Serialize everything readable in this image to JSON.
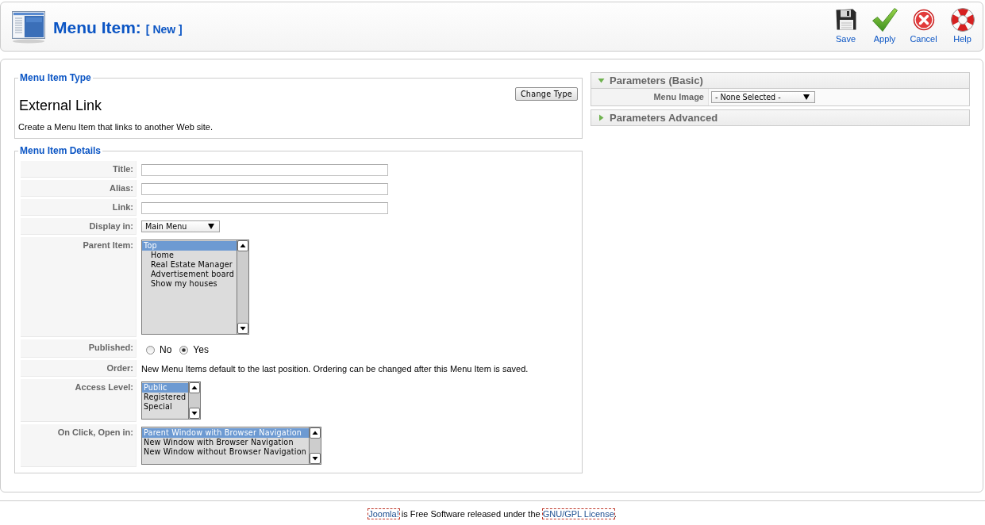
{
  "header": {
    "title": "Menu Item:",
    "subtitle": "[ New ]"
  },
  "toolbar": [
    {
      "kind": "save",
      "label": "Save"
    },
    {
      "kind": "apply",
      "label": "Apply"
    },
    {
      "kind": "cancel",
      "label": "Cancel"
    },
    {
      "kind": "help",
      "label": "Help"
    }
  ],
  "menu_item_type": {
    "legend": "Menu Item Type",
    "type_name": "External Link",
    "change_button": "Change Type",
    "description": "Create a Menu Item that links to another Web site."
  },
  "menu_item_details": {
    "legend": "Menu Item Details",
    "rows": [
      {
        "kind": "text",
        "label": "Title:"
      },
      {
        "kind": "text",
        "label": "Alias:"
      },
      {
        "kind": "text",
        "label": "Link:"
      },
      {
        "kind": "select",
        "label": "Display in:",
        "value": "Main Menu"
      },
      {
        "kind": "listbox",
        "label": "Parent Item:",
        "options": [
          {
            "label": "Top",
            "selected": true,
            "children": [
              {
                "label": "Home",
                "selected": false
              },
              {
                "label": "Real Estate Manager",
                "selected": false
              },
              {
                "label": "Advertisement board",
                "selected": false
              },
              {
                "label": "Show my houses",
                "selected": false
              }
            ]
          }
        ]
      },
      {
        "kind": "radio",
        "label": "Published:",
        "options": [
          {
            "label": "No",
            "selected": false
          },
          {
            "label": "Yes",
            "selected": true
          }
        ]
      },
      {
        "kind": "note",
        "label": "Order:",
        "text": "New Menu Items default to the last position. Ordering can be changed after this Menu Item is saved."
      },
      {
        "kind": "listbox",
        "label": "Access Level:",
        "options": [
          {
            "label": "Public",
            "selected": true
          },
          {
            "label": "Registered",
            "selected": false
          },
          {
            "label": "Special",
            "selected": false
          }
        ]
      },
      {
        "kind": "listbox",
        "label": "On Click, Open in:",
        "options": [
          {
            "label": "Parent Window with Browser Navigation",
            "selected": true
          },
          {
            "label": "New Window with Browser Navigation",
            "selected": false
          },
          {
            "label": "New Window without Browser Navigation",
            "selected": false
          }
        ]
      }
    ]
  },
  "parameters": [
    {
      "title": "Parameters (Basic)",
      "expanded": true,
      "rows": [
        {
          "label": "Menu Image",
          "value": "- None Selected -"
        }
      ]
    },
    {
      "title": "Parameters Advanced",
      "expanded": false
    }
  ],
  "footer": {
    "segments": [
      {
        "kind": "link",
        "text": "Joomla!"
      },
      {
        "kind": "text",
        "text": " is Free Software released under the "
      },
      {
        "kind": "link",
        "text": "GNU/GPL License"
      },
      {
        "kind": "text",
        "text": "."
      }
    ]
  }
}
